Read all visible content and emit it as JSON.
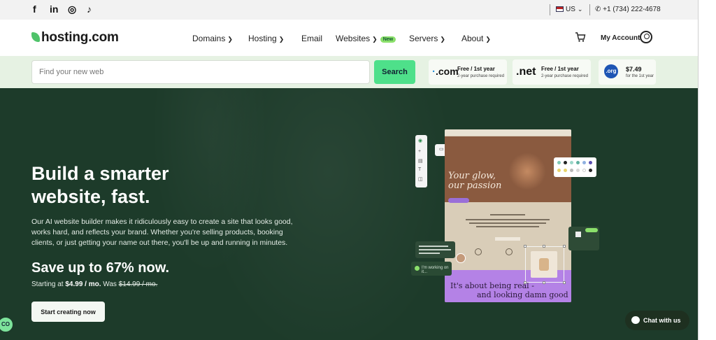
{
  "topbar": {
    "social": [
      "f",
      "in",
      "◎",
      "♪"
    ],
    "locale": "US",
    "phone": "+1 (734) 222-4678"
  },
  "nav": {
    "logo": "hosting.com",
    "items": [
      {
        "label": "Domains"
      },
      {
        "label": "Hosting"
      },
      {
        "label": "Email"
      },
      {
        "label": "Websites",
        "badge": "New"
      },
      {
        "label": "Servers"
      },
      {
        "label": "About"
      }
    ],
    "account": "My Account"
  },
  "domain_search": {
    "placeholder": "Find your new web",
    "button": "Search",
    "offers": [
      {
        "tld": ".com",
        "line1": "Free / 1st year",
        "line2": "2-year purchase required"
      },
      {
        "tld": ".net",
        "line1": "Free / 1st year",
        "line2": "2-year purchase required"
      },
      {
        "tld": ".org",
        "line1": "$7.49",
        "line2": "for the 1st year"
      }
    ]
  },
  "hero": {
    "title_line1": "Build a smarter",
    "title_line2": "website, fast.",
    "body": "Our AI website builder makes it ridiculously easy to create a site that looks good, works hard, and reflects your brand. Whether you're selling products, booking clients, or just getting your name out there, you'll be up and running in minutes.",
    "save": "Save up to 67% now.",
    "price_prefix": "Starting at",
    "price": "$4.99 / mo.",
    "price_was_label": "Was",
    "price_was": "$14.99 / mo.",
    "cta": "Start creating now"
  },
  "mockup": {
    "headline_1": "Your glow,",
    "headline_2": "our passion",
    "footer_1": "It's about being real -",
    "footer_2": "and looking damn good",
    "ai_status": "I'm working on it...",
    "palette_colors": [
      "#7fc9b5",
      "#222222",
      "#9ad6c8",
      "#5fb1a0",
      "#8fb0e0",
      "#5a4fb0",
      "#e8d36a",
      "#e8d36a",
      "#b9b9b9",
      "#d7d7d7",
      "#ffffff",
      "#222222"
    ]
  },
  "chat": {
    "label": "Chat with us"
  },
  "corner_widget": "CO"
}
